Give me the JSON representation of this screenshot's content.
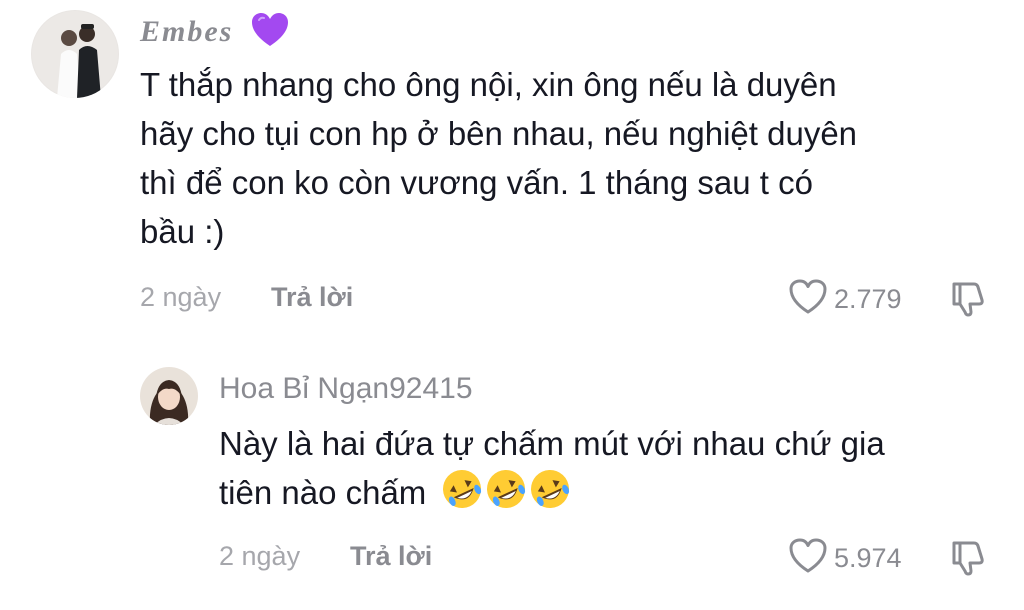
{
  "comments": [
    {
      "username": "Embes",
      "username_emoji": "purple-heart-icon",
      "lines": [
        "T thắp nhang cho ông nội, xin ông nếu là duyên",
        "hãy cho tụi con hp ở bên nhau, nếu nghiệt duyên",
        "thì để con ko còn vương vấn. 1 tháng sau t có",
        "bầu :)"
      ],
      "time": "2 ngày",
      "reply_label": "Trả lời",
      "likes": "2.779"
    },
    {
      "username": "Hoa Bỉ Ngạn92415",
      "line1": "Này là hai đứa tự chấm mút với nhau chứ gia",
      "line2": "tiên nào chấm",
      "emojis": [
        "rolling-on-floor-laughing-icon",
        "rolling-on-floor-laughing-icon",
        "rolling-on-floor-laughing-icon"
      ],
      "time": "2 ngày",
      "reply_label": "Trả lời",
      "likes": "5.974"
    }
  ],
  "colors": {
    "text": "#161823",
    "muted": "#8a8b91",
    "time": "#a6a7ac",
    "purple_heart": "#a349f0",
    "emoji_yellow": "#ffcc33"
  }
}
